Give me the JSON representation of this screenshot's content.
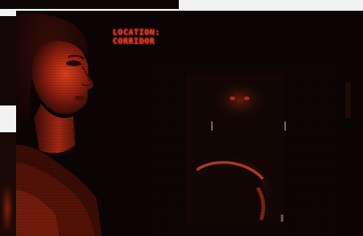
{
  "hud": {
    "location_label": "LOCATION:",
    "location_value": "CORRIDOR"
  },
  "icons": {
    "portrait": "player-portrait-icon",
    "corridor": "corridor-scene-icon"
  },
  "colors": {
    "hud_text": "#e03422",
    "background": "#0a0404",
    "portrait_skin": "#b02a16",
    "shadow_red": "#3a0c06"
  }
}
